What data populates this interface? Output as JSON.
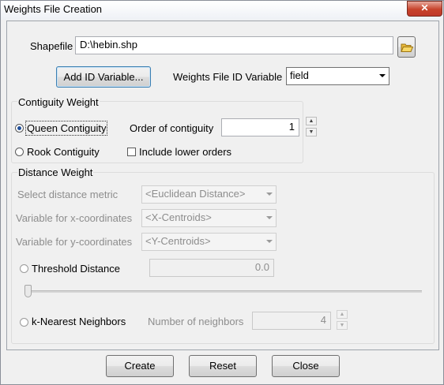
{
  "window": {
    "title": "Weights File Creation",
    "close_glyph": "✕"
  },
  "shapefile": {
    "label": "Shapefile",
    "value": "D:\\hebin.shp",
    "browse_icon": "folder-open-icon"
  },
  "id_variable": {
    "add_button": "Add ID Variable...",
    "label": "Weights File ID Variable",
    "selected": "field"
  },
  "contiguity": {
    "title": "Contiguity Weight",
    "queen_label": "Queen Contiguity",
    "queen_selected": true,
    "rook_label": "Rook Contiguity",
    "order_label": "Order of contiguity",
    "order_value": "1",
    "include_lower_label": "Include lower orders",
    "include_lower_checked": false
  },
  "distance": {
    "title": "Distance Weight",
    "metric_label": "Select distance metric",
    "metric_value": "<Euclidean Distance>",
    "x_label": "Variable for x-coordinates",
    "x_value": "<X-Centroids>",
    "y_label": "Variable for y-coordinates",
    "y_value": "<Y-Centroids>",
    "threshold_label": "Threshold Distance",
    "threshold_value": "0.0",
    "threshold_slider_level": 0,
    "knn_label": "k-Nearest Neighbors",
    "neighbors_label": "Number of neighbors",
    "neighbors_value": "4"
  },
  "buttons": {
    "create": "Create",
    "reset": "Reset",
    "close": "Close"
  },
  "colors": {
    "radio_dot": "#1f4f9a",
    "close_button": "#c7432b",
    "focus_border": "#3c7fb1"
  }
}
